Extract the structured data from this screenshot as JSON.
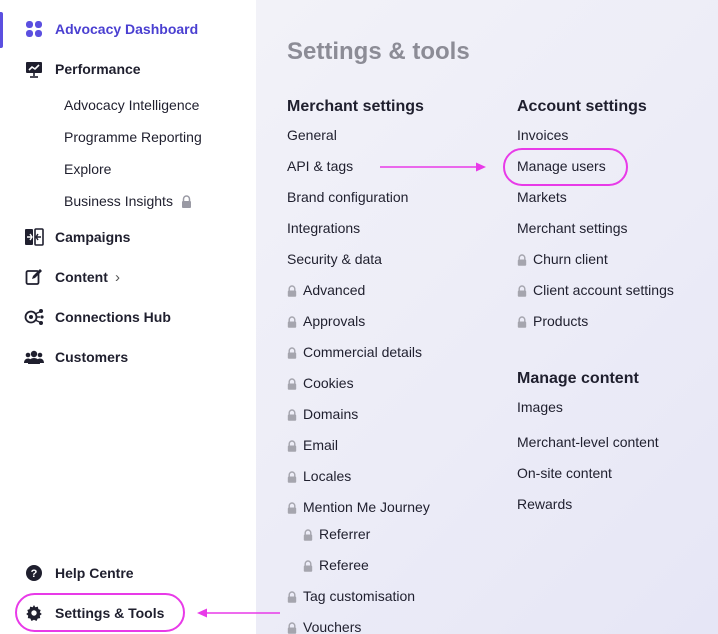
{
  "sidebar": {
    "items": [
      {
        "label": "Advocacy Dashboard",
        "icon": "grid-icon"
      },
      {
        "label": "Performance",
        "icon": "chart-board-icon"
      },
      {
        "label": "Campaigns",
        "icon": "campaigns-icon"
      },
      {
        "label": "Content",
        "icon": "edit-icon",
        "chevron": "›"
      },
      {
        "label": "Connections Hub",
        "icon": "connections-icon"
      },
      {
        "label": "Customers",
        "icon": "users-icon"
      },
      {
        "label": "Help Centre",
        "icon": "help-icon"
      },
      {
        "label": "Settings & Tools",
        "icon": "gear-icon"
      }
    ],
    "performance_sub": [
      {
        "label": "Advocacy Intelligence"
      },
      {
        "label": "Programme Reporting"
      },
      {
        "label": "Explore"
      },
      {
        "label": "Business Insights",
        "locked": true
      }
    ]
  },
  "main": {
    "title": "Settings & tools",
    "merchant_settings": {
      "heading": "Merchant settings",
      "links": [
        "General",
        "API & tags",
        "Brand configuration",
        "Integrations",
        "Security & data"
      ],
      "locked_links": [
        "Advanced",
        "Approvals",
        "Commercial details",
        "Cookies",
        "Domains",
        "Email",
        "Locales",
        "Mention Me Journey"
      ],
      "journey_sub": [
        "Referrer",
        "Referee"
      ],
      "locked_links_2": [
        "Tag customisation",
        "Vouchers"
      ]
    },
    "account_settings": {
      "heading": "Account settings",
      "links": [
        "Invoices",
        "Manage users",
        "Markets",
        "Merchant settings"
      ],
      "locked_links": [
        "Churn client",
        "Client account settings",
        "Products"
      ]
    },
    "manage_content": {
      "heading": "Manage content",
      "links": [
        "Images",
        "Merchant-level content",
        "On-site content",
        "Rewards"
      ]
    }
  },
  "colors": {
    "accent": "#4a3fd1",
    "annotation": "#e83ae8",
    "main_bg": "#ececf7"
  }
}
